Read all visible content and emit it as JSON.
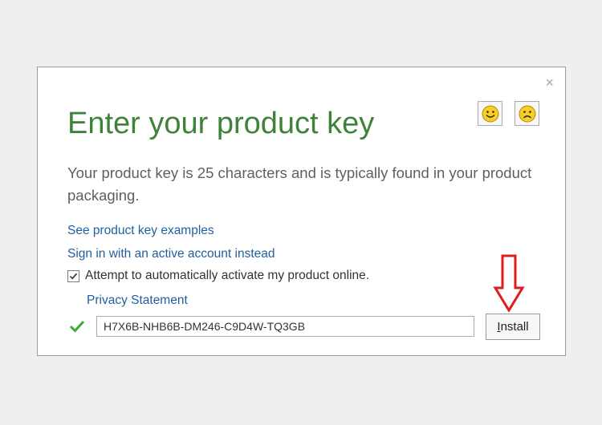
{
  "dialog": {
    "close_glyph": "×",
    "title": "Enter your product key",
    "description": "Your product key is 25 characters and is typically found in your product packaging.",
    "links": {
      "examples": "See product key examples",
      "signin": "Sign in with an active account instead",
      "privacy": "Privacy Statement"
    },
    "auto_activate": {
      "label": "Attempt to automatically activate my product online.",
      "checked": true
    },
    "product_key": {
      "value": "H7X6B-NHB6B-DM246-C9D4W-TQ3GB",
      "valid": true
    },
    "install_button": {
      "accel": "I",
      "rest": "nstall"
    }
  },
  "colors": {
    "title_green": "#3d843a",
    "link_blue": "#1f5f9e",
    "annotation_red": "#e01b1b",
    "smiley_yellow": "#f7cf24",
    "valid_green": "#3aa935"
  },
  "icons": [
    "close-icon",
    "smiley-icon",
    "frown-icon",
    "checkbox-check-icon",
    "valid-check-icon",
    "red-down-arrow-icon"
  ]
}
